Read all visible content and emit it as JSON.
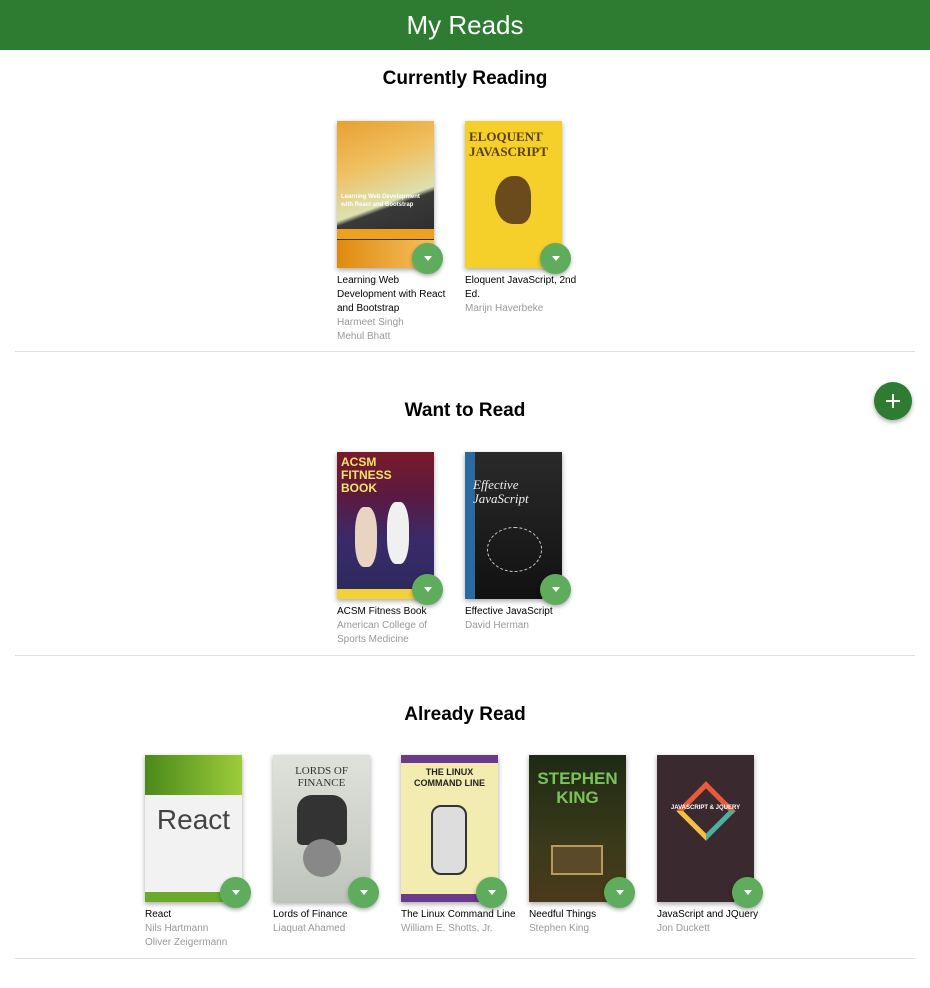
{
  "app": {
    "title": "My Reads"
  },
  "shelves": [
    {
      "title": "Currently Reading",
      "books": [
        {
          "title": "Learning Web Development with React and Bootstrap",
          "authors": [
            "Harmeet Singh",
            "Mehul Bhatt"
          ],
          "cover_text": "Learning Web Development with React and Bootstrap"
        },
        {
          "title": "Eloquent JavaScript, 2nd Ed.",
          "authors": [
            "Marijn Haverbeke"
          ],
          "cover_text": "ELOQUENT JAVASCRIPT"
        }
      ]
    },
    {
      "title": "Want to Read",
      "books": [
        {
          "title": "ACSM Fitness Book",
          "authors": [
            "American College of Sports Medicine"
          ],
          "cover_text": "ACSM FITNESS BOOK"
        },
        {
          "title": "Effective JavaScript",
          "authors": [
            "David Herman"
          ],
          "cover_text": "Effective JavaScript"
        }
      ]
    },
    {
      "title": "Already Read",
      "books": [
        {
          "title": "React",
          "authors": [
            "Nils Hartmann",
            "Oliver Zeigermann"
          ],
          "cover_text": "React"
        },
        {
          "title": "Lords of Finance",
          "authors": [
            "Liaquat Ahamed"
          ],
          "cover_text": "LORDS OF FINANCE"
        },
        {
          "title": "The Linux Command Line",
          "authors": [
            "William E. Shotts, Jr."
          ],
          "cover_text": "THE LINUX COMMAND LINE"
        },
        {
          "title": "Needful Things",
          "authors": [
            "Stephen King"
          ],
          "cover_text": "STEPHEN KING"
        },
        {
          "title": "JavaScript and JQuery",
          "authors": [
            "Jon Duckett"
          ],
          "cover_text": "JAVASCRIPT & JQUERY"
        }
      ]
    }
  ],
  "colors": {
    "header": "#2e7c31",
    "shelf_changer": "#60ac5d",
    "add_button": "#2e7c31",
    "author_text": "#999999"
  },
  "icons": {
    "shelf_changer": "triangle-down-icon",
    "add": "plus-icon"
  }
}
